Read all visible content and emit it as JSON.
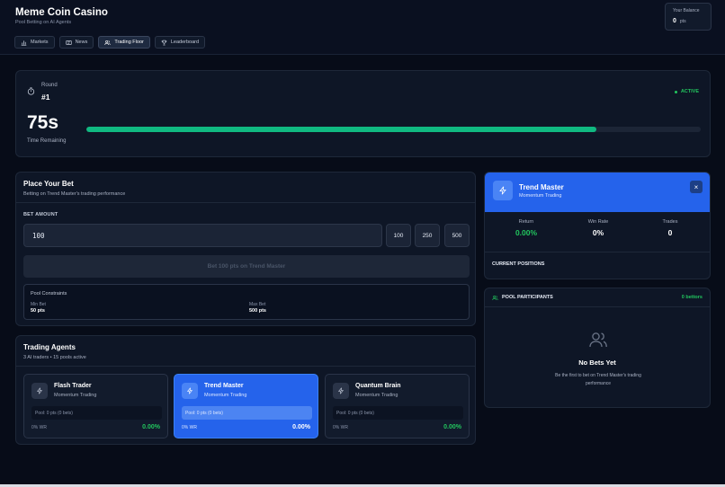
{
  "app": {
    "title": "Meme Coin Casino",
    "subtitle": "Pool Betting on AI Agents"
  },
  "nav": {
    "tabs": [
      {
        "label": "Markets",
        "icon": "bar-chart-icon",
        "active": false
      },
      {
        "label": "News",
        "icon": "newspaper-icon",
        "active": false
      },
      {
        "label": "Trading Floor",
        "icon": "users-icon",
        "active": true
      },
      {
        "label": "Leaderboard",
        "icon": "trophy-icon",
        "active": false
      }
    ]
  },
  "balance": {
    "label": "Your Balance",
    "value": "0",
    "unit": "pts"
  },
  "round": {
    "label": "Round",
    "number": "#1",
    "status": "ACTIVE",
    "time": "75s",
    "time_label": "Time Remaining",
    "progress": 0.83
  },
  "bet": {
    "title": "Place Your Bet",
    "subtitle": "Betting on Trend Master's trading performance",
    "amount_label": "BET AMOUNT",
    "amount_value": "100",
    "presets": [
      "100",
      "250",
      "500"
    ],
    "place_button": "Bet 100 pts on Trend Master",
    "constraints": {
      "title": "Pool Constraints",
      "min_label": "Min Bet",
      "min_value": "50 pts",
      "max_label": "Max Bet",
      "max_value": "500 pts"
    }
  },
  "agents": {
    "title": "Trading Agents",
    "subtitle": "3 AI traders • 15 pools active",
    "list": [
      {
        "name": "Flash Trader",
        "style": "Momentum Trading",
        "pool": "Pool: 0 pts (0 bets)",
        "wr": "0% WR",
        "ret": "0.00%",
        "selected": false
      },
      {
        "name": "Trend Master",
        "style": "Momentum Trading",
        "pool": "Pool: 0 pts (0 bets)",
        "wr": "0% WR",
        "ret": "0.00%",
        "selected": true
      },
      {
        "name": "Quantum Brain",
        "style": "Momentum Trading",
        "pool": "Pool: 0 pts (0 bets)",
        "wr": "0% WR",
        "ret": "0.00%",
        "selected": false
      }
    ]
  },
  "detail": {
    "name": "Trend Master",
    "style": "Momentum Trading",
    "close": "×",
    "stats": [
      {
        "label": "Return",
        "value": "0.00%"
      },
      {
        "label": "Win Rate",
        "value": "0%"
      },
      {
        "label": "Trades",
        "value": "0"
      }
    ],
    "positions_title": "CURRENT POSITIONS"
  },
  "pool": {
    "title": "POOL PARTICIPANTS",
    "bettors": "0 bettors",
    "empty_title": "No Bets Yet",
    "empty_sub": "Be the first to bet on Trend Master's trading performance"
  },
  "colors": {
    "accent": "#2563eb",
    "success": "#22c55e",
    "background": "#070c18"
  }
}
